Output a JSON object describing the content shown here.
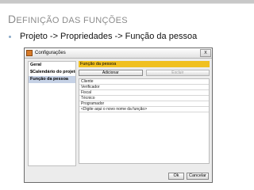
{
  "slide": {
    "title_first": "D",
    "title_rest": "EFINIÇÃO DAS FUNÇÕES",
    "bullet": "Projeto -> Propriedades -> Função da pessoa"
  },
  "dialog": {
    "title": "Configurações",
    "close_label": "x",
    "sidebar": [
      "Geral",
      "$Calendário do projeto",
      "Função da pessoa"
    ],
    "selected_item": "Função da pessoa",
    "panel_heading": "Função da pessoa",
    "buttons": {
      "add": "Adicionar",
      "delete": "Excluir"
    },
    "list": [
      "Cliente",
      "Verificador",
      "Fiscal",
      "Técnico",
      "Programador",
      "<Digite aqui o novo nome da função>"
    ],
    "footer": {
      "ok": "Ok",
      "cancel": "Cancelar"
    }
  },
  "colors": {
    "panel_heading": "#f0c020",
    "selected_sidebar": "#c6d2e6",
    "slide_title": "#8b8b8b"
  }
}
